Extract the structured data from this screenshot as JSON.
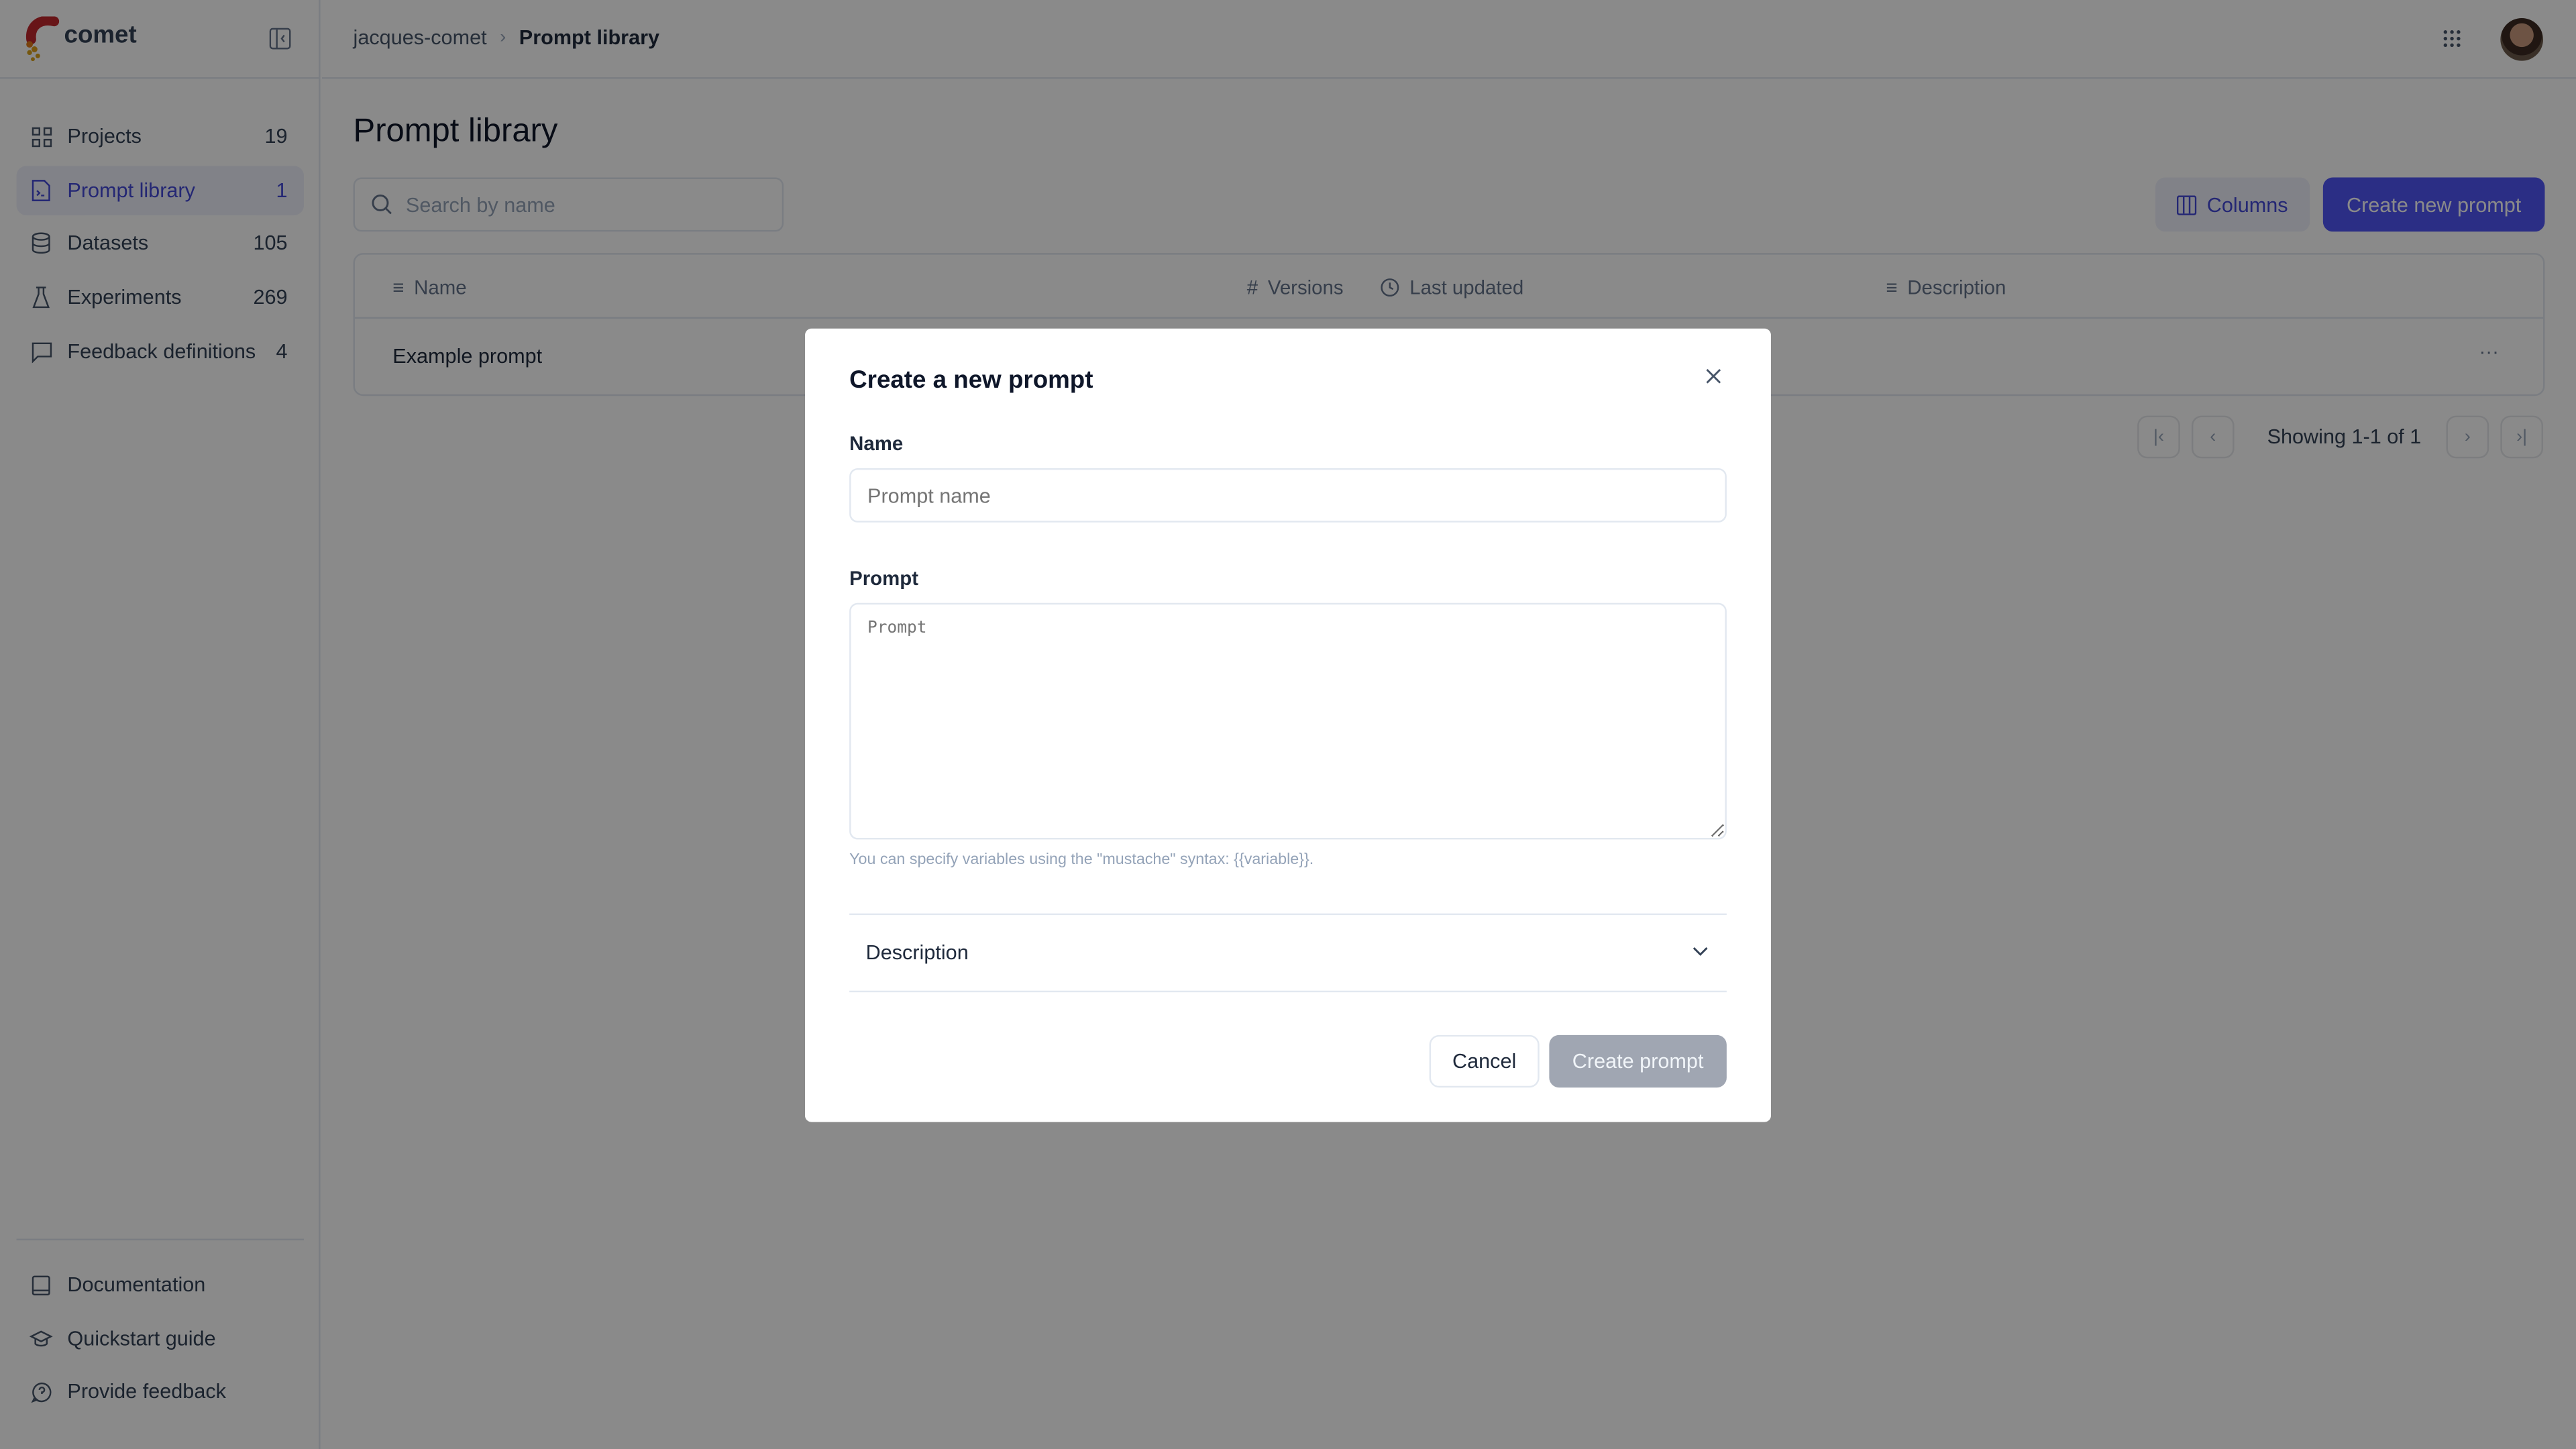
{
  "brand": {
    "name": "comet"
  },
  "sidebar": {
    "items": [
      {
        "label": "Projects",
        "count": "19",
        "icon": "grid-icon"
      },
      {
        "label": "Prompt library",
        "count": "1",
        "icon": "file-code-icon",
        "active": true
      },
      {
        "label": "Datasets",
        "count": "105",
        "icon": "database-icon"
      },
      {
        "label": "Experiments",
        "count": "269",
        "icon": "flask-icon"
      },
      {
        "label": "Feedback definitions",
        "count": "4",
        "icon": "message-square-icon"
      }
    ],
    "footer": [
      {
        "label": "Documentation",
        "icon": "book-icon"
      },
      {
        "label": "Quickstart guide",
        "icon": "graduation-cap-icon"
      },
      {
        "label": "Provide feedback",
        "icon": "message-help-icon"
      }
    ]
  },
  "breadcrumb": {
    "workspace": "jacques-comet",
    "current": "Prompt library"
  },
  "page": {
    "title": "Prompt library",
    "search_placeholder": "Search by name",
    "columns_label": "Columns",
    "create_label": "Create new prompt",
    "accent": "#5155f5"
  },
  "table": {
    "headers": [
      {
        "label": "Name",
        "icon": "text-icon"
      },
      {
        "label": "Versions",
        "icon": "hash-icon"
      },
      {
        "label": "Last updated",
        "icon": "clock-icon"
      },
      {
        "label": "Description",
        "icon": "text-icon"
      }
    ],
    "rows": [
      {
        "name": "Example prompt"
      }
    ]
  },
  "pagination": {
    "text": "Showing 1-1 of 1"
  },
  "modal": {
    "title": "Create a new prompt",
    "name_label": "Name",
    "name_placeholder": "Prompt name",
    "prompt_label": "Prompt",
    "prompt_placeholder": "Prompt",
    "hint": "You can specify variables using the \"mustache\" syntax: {{variable}}.",
    "description_label": "Description",
    "cancel_label": "Cancel",
    "submit_label": "Create prompt"
  }
}
